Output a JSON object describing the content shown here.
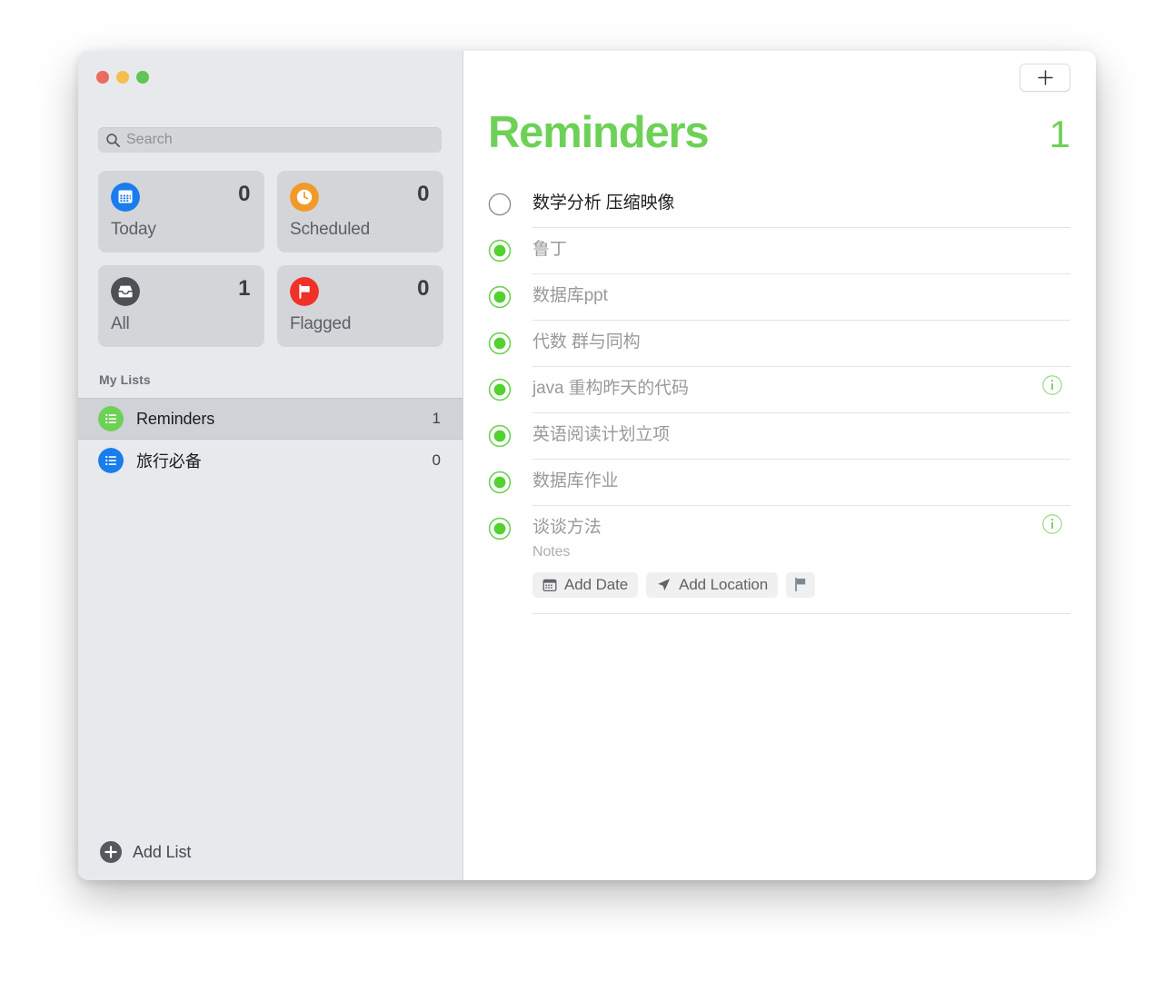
{
  "window": {
    "traffic_lights": [
      {
        "name": "close",
        "color": "#ec6a5f"
      },
      {
        "name": "minimize",
        "color": "#f4bf50"
      },
      {
        "name": "zoom",
        "color": "#61c454"
      }
    ]
  },
  "sidebar": {
    "search": {
      "placeholder": "Search",
      "value": "",
      "icon": "search-icon"
    },
    "smart_lists": [
      {
        "id": "today",
        "label": "Today",
        "count": "0",
        "icon": "calendar-icon",
        "color": "#1a7ced"
      },
      {
        "id": "scheduled",
        "label": "Scheduled",
        "count": "0",
        "icon": "clock-icon",
        "color": "#f29a28"
      },
      {
        "id": "all",
        "label": "All",
        "count": "1",
        "icon": "inbox-icon",
        "color": "#4e5055"
      },
      {
        "id": "flagged",
        "label": "Flagged",
        "count": "0",
        "icon": "flag-icon",
        "color": "#f03127"
      }
    ],
    "my_lists_header": "My Lists",
    "lists": [
      {
        "id": "reminders",
        "name": "Reminders",
        "count": "1",
        "color": "#6ed157",
        "selected": true
      },
      {
        "id": "travel",
        "name": "旅行必备",
        "count": "0",
        "color": "#1a7ced",
        "selected": false
      }
    ],
    "add_list": {
      "label": "Add List",
      "icon": "plus-circle-icon"
    }
  },
  "main": {
    "add_button": {
      "icon": "plus-icon",
      "label": ""
    },
    "title": "Reminders",
    "accent_color": "#6ed157",
    "total": "1",
    "reminders": [
      {
        "title": "数学分析 压缩映像",
        "completed": false,
        "has_info": false,
        "expanded": false
      },
      {
        "title": "鲁丁",
        "completed": true,
        "has_info": false,
        "expanded": false
      },
      {
        "title": "数据库ppt",
        "completed": true,
        "has_info": false,
        "expanded": false
      },
      {
        "title": "代数 群与同构",
        "completed": true,
        "has_info": false,
        "expanded": false
      },
      {
        "title": "java 重构昨天的代码",
        "completed": true,
        "has_info": true,
        "expanded": false
      },
      {
        "title": "英语阅读计划立项",
        "completed": true,
        "has_info": false,
        "expanded": false
      },
      {
        "title": "数据库作业",
        "completed": true,
        "has_info": false,
        "expanded": false
      },
      {
        "title": "谈谈方法",
        "completed": true,
        "has_info": true,
        "expanded": true,
        "notes_placeholder": "Notes",
        "actions": [
          {
            "id": "add-date",
            "label": "Add Date",
            "icon": "calendar-icon"
          },
          {
            "id": "add-location",
            "label": "Add Location",
            "icon": "location-arrow-icon"
          },
          {
            "id": "flag",
            "label": "",
            "icon": "flag-icon"
          }
        ]
      }
    ]
  }
}
